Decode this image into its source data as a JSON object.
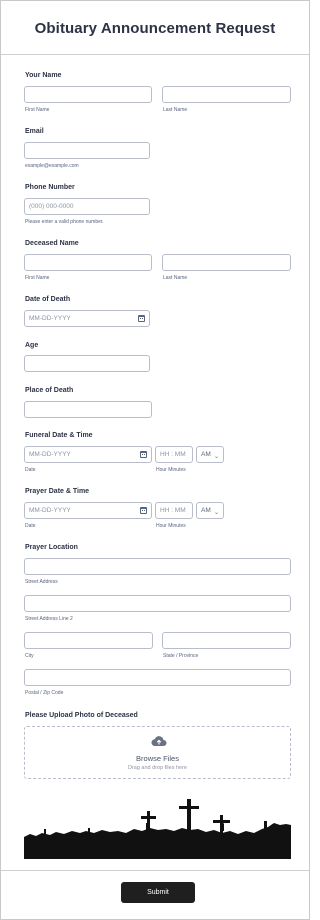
{
  "form": {
    "title": "Obituary Announcement Request",
    "your_name": {
      "label": "Your Name",
      "first": "First Name",
      "last": "Last Name"
    },
    "email": {
      "label": "Email",
      "sub": "example@example.com"
    },
    "phone": {
      "label": "Phone Number",
      "placeholder": "(000) 000-0000",
      "sub": "Please enter a valid phone number."
    },
    "deceased_name": {
      "label": "Deceased Name",
      "first": "First Name",
      "last": "Last Name"
    },
    "date_of_death": {
      "label": "Date of Death",
      "placeholder": "MM-DD-YYYY"
    },
    "age": {
      "label": "Age"
    },
    "place_of_death": {
      "label": "Place of Death"
    },
    "funeral": {
      "label": "Funeral Date & Time",
      "date_placeholder": "MM-DD-YYYY",
      "time_placeholder": "HH : MM",
      "ampm": "AM",
      "date_sub": "Date",
      "time_sub": "Hour Minutes"
    },
    "prayer": {
      "label": "Prayer Date & Time",
      "date_placeholder": "MM-DD-YYYY",
      "time_placeholder": "HH : MM",
      "ampm": "AM",
      "date_sub": "Date",
      "time_sub": "Hour Minutes"
    },
    "prayer_location": {
      "label": "Prayer Location",
      "street": "Street Address",
      "street2": "Street Address Line 2",
      "city": "City",
      "state": "State / Province",
      "postal": "Postal / Zip Code"
    },
    "upload": {
      "label": "Please Upload Photo of Deceased",
      "browse": "Browse Files",
      "drag": "Drag and drop files here"
    },
    "submit": "Submit"
  },
  "icons": {
    "calendar": "calendar-icon",
    "chevron": "chevron-down-icon",
    "upload": "cloud-upload-icon"
  },
  "colors": {
    "text": "#2c3345",
    "border": "#b8bdc9",
    "button": "#1f1f1f"
  }
}
